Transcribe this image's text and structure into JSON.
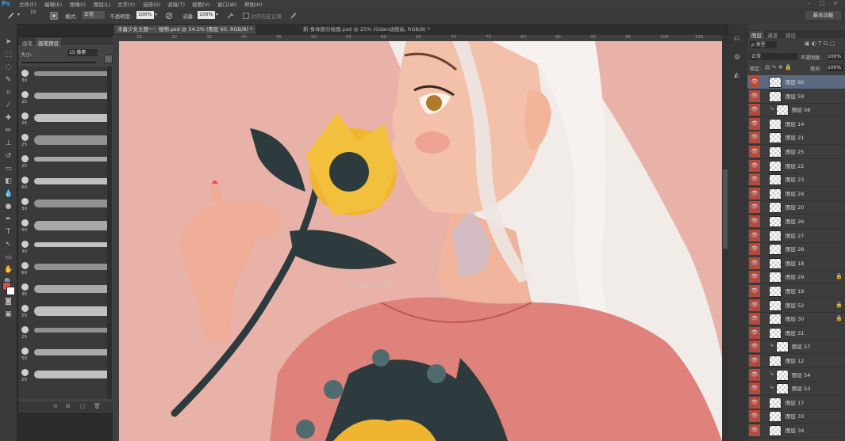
{
  "menu": {
    "logo": "Ps",
    "items": [
      "文件(F)",
      "编辑(E)",
      "图像(I)",
      "图层(L)",
      "文字(Y)",
      "选择(S)",
      "滤镜(T)",
      "视图(V)",
      "窗口(W)",
      "帮助(H)"
    ],
    "window_controls": [
      "–",
      "□",
      "×"
    ]
  },
  "options": {
    "brush_size": "15",
    "mode_label": "模式:",
    "mode_value": "正常",
    "opacity_label": "不透明度:",
    "opacity_value": "100%",
    "flow_label": "流量:",
    "flow_value": "100%",
    "history_label": "对齐历史记录",
    "workspace": "基本功能"
  },
  "doc_tabs": [
    {
      "label": "未备少女主题一：植物.psd @ 54.3% (图层 60, RGB/8) *",
      "active": true
    },
    {
      "label": "新·身体部分绘画.psd @ 25% (Odan动画站, RGB/8) *",
      "active": false
    }
  ],
  "ruler_marks": [
    "25",
    "30",
    "35",
    "40",
    "45",
    "50",
    "55",
    "60",
    "65",
    "70",
    "75",
    "80",
    "85",
    "90",
    "95",
    "100",
    "105"
  ],
  "brush_panel": {
    "tabs": [
      "画笔",
      "画笔预设"
    ],
    "size_label": "大小:",
    "size_value": "15 像素",
    "preset_sizes": [
      "30",
      "25",
      "25",
      "25",
      "25",
      "60",
      "30",
      "50",
      "30",
      "60",
      "35",
      "25",
      "25",
      "50",
      "25"
    ]
  },
  "watermark": "charonet",
  "layers_panel": {
    "tabs": [
      "图层",
      "通道",
      "路径"
    ],
    "filter_kind": "ρ 类型",
    "blend_mode": "正常",
    "opacity_label": "不透明度:",
    "opacity_value": "100%",
    "lock_label": "锁定:",
    "fill_label": "填充:",
    "fill_value": "100%",
    "layers": [
      {
        "name": "图层 60",
        "indent": false,
        "selected": true
      },
      {
        "name": "图层 59",
        "indent": false,
        "selected": false
      },
      {
        "name": "图层 56",
        "indent": true,
        "selected": false
      },
      {
        "name": "图层 14",
        "indent": false,
        "selected": false
      },
      {
        "name": "图层 21",
        "indent": false,
        "selected": false
      },
      {
        "name": "图层 25",
        "indent": false,
        "selected": false
      },
      {
        "name": "图层 22",
        "indent": false,
        "selected": false
      },
      {
        "name": "图层 23",
        "indent": false,
        "selected": false
      },
      {
        "name": "图层 24",
        "indent": false,
        "selected": false
      },
      {
        "name": "图层 20",
        "indent": false,
        "selected": false
      },
      {
        "name": "图层 26",
        "indent": false,
        "selected": false
      },
      {
        "name": "图层 27",
        "indent": false,
        "selected": false
      },
      {
        "name": "图层 28",
        "indent": false,
        "selected": false
      },
      {
        "name": "图层 18",
        "indent": false,
        "selected": false
      },
      {
        "name": "图层 29",
        "indent": false,
        "selected": false
      },
      {
        "name": "图层 19",
        "indent": false,
        "selected": false
      },
      {
        "name": "图层 52",
        "indent": false,
        "selected": false
      },
      {
        "name": "图层 30",
        "indent": false,
        "selected": false
      },
      {
        "name": "图层 31",
        "indent": false,
        "selected": false
      },
      {
        "name": "图层 57",
        "indent": true,
        "selected": false
      },
      {
        "name": "图层 12",
        "indent": false,
        "selected": false
      },
      {
        "name": "图层 54",
        "indent": true,
        "selected": false
      },
      {
        "name": "图层 53",
        "indent": true,
        "selected": false
      },
      {
        "name": "图层 17",
        "indent": false,
        "selected": false
      },
      {
        "name": "图层 33",
        "indent": false,
        "selected": false
      },
      {
        "name": "图层 34",
        "indent": false,
        "selected": false
      }
    ]
  },
  "colors": {
    "foreground": "#d9534a",
    "background": "#ffffff",
    "canvas_bg": "#e9b2a8",
    "hair": "#f2ece9",
    "skin": "#f1b8a0",
    "shirt": "#e0827c",
    "flower": "#efb430",
    "leaf": "#2e3b3e"
  }
}
